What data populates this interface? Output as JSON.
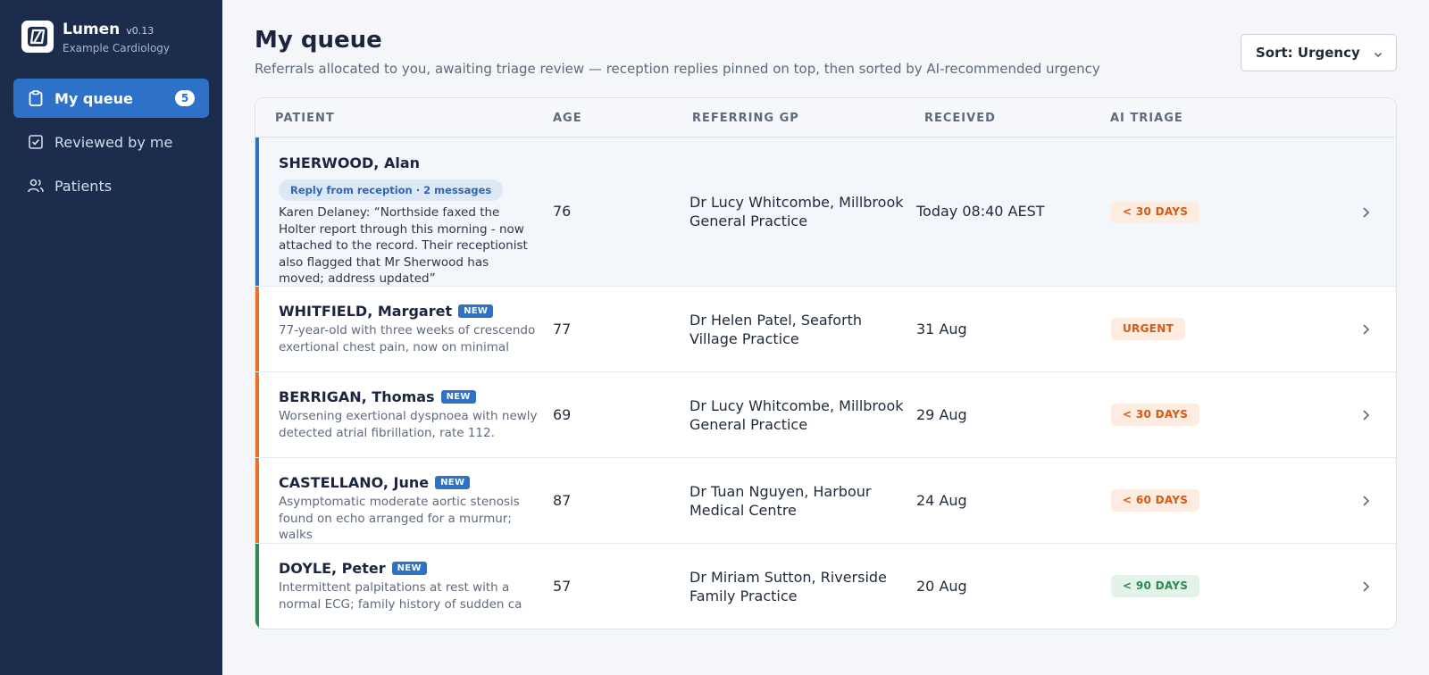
{
  "app": {
    "name": "Lumen",
    "version": "v0.13",
    "org": "Example Cardiology"
  },
  "sidebar": {
    "items": [
      {
        "label": "My queue",
        "icon": "clipboard-icon",
        "badge": "5",
        "active": true
      },
      {
        "label": "Reviewed by me",
        "icon": "check-square-icon"
      },
      {
        "label": "Patients",
        "icon": "users-icon"
      }
    ]
  },
  "header": {
    "title": "My queue",
    "subtitle": "Referrals allocated to you, awaiting triage review — reception replies pinned on top, then sorted by AI-recommended urgency",
    "sort_label": "Sort: Urgency"
  },
  "table": {
    "columns": [
      "PATIENT",
      "AGE",
      "REFERRING GP",
      "RECEIVED",
      "AI TRIAGE"
    ],
    "rows": [
      {
        "name": "SHERWOOD, Alan",
        "reply": "Reply from reception · 2 messages",
        "summary": "Karen Delaney: “Northside faxed the Holter report through this morning - now attached to the record. Their receptionist also flagged that Mr Sherwood has moved; address updated”",
        "age": "76",
        "gp": "Dr Lucy Whitcombe, Millbrook General Practice",
        "received": "Today 08:40 AEST",
        "triage": "< 30 DAYS",
        "accent": "#2e71c8"
      },
      {
        "name": "WHITFIELD, Margaret",
        "new": "NEW",
        "summary": "77-year-old with three weeks of crescendo exertional chest pain, now on minimal",
        "age": "77",
        "gp": "Dr Helen Patel, Seaforth Village Practice",
        "received": "31 Aug",
        "triage": "URGENT",
        "accent": "#e8712a"
      },
      {
        "name": "BERRIGAN, Thomas",
        "new": "NEW",
        "summary": "Worsening exertional dyspnoea with newly detected atrial fibrillation, rate 112.",
        "age": "69",
        "gp": "Dr Lucy Whitcombe, Millbrook General Practice",
        "received": "29 Aug",
        "triage": "< 30 DAYS",
        "accent": "#e8712a"
      },
      {
        "name": "CASTELLANO, June",
        "new": "NEW",
        "summary": "Asymptomatic moderate aortic stenosis found on echo arranged for a murmur; walks",
        "age": "87",
        "gp": "Dr Tuan Nguyen, Harbour Medical Centre",
        "received": "24 Aug",
        "triage": "< 60 DAYS",
        "accent": "#e8712a"
      },
      {
        "name": "DOYLE, Peter",
        "new": "NEW",
        "summary": "Intermittent palpitations at rest with a normal ECG; family history of sudden ca",
        "age": "57",
        "gp": "Dr Miriam Sutton, Riverside Family Practice",
        "received": "20 Aug",
        "triage": "< 90 DAYS",
        "accent": "#2e8a55"
      }
    ]
  }
}
